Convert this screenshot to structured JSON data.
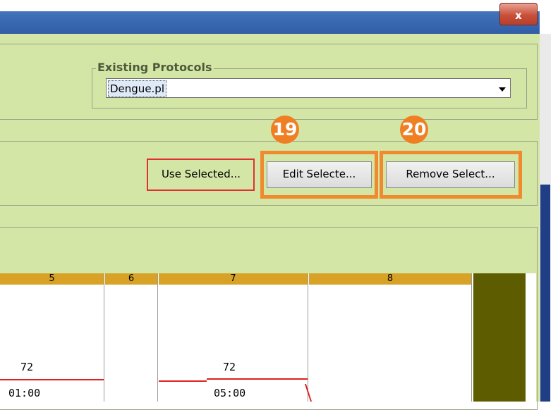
{
  "window": {
    "close_label": "x"
  },
  "protocols": {
    "legend": "Existing Protocols",
    "selected_value": "Dengue.pl"
  },
  "actions": {
    "use_selected": "Use Selected...",
    "edit_selected": "Edit Selecte...",
    "remove_selected": "Remove Select..."
  },
  "callouts": {
    "badge_edit": "19",
    "badge_remove": "20"
  },
  "grid": {
    "columns": [
      "5",
      "6",
      "7",
      "8"
    ],
    "values": {
      "col5_value": "72",
      "col5_time": "01:00",
      "col7_value": "72",
      "col7_time": "05:00"
    }
  },
  "colors": {
    "panel_bg": "#d4e6a6",
    "header_gold": "#d8a227",
    "callout_orange": "#f08a2e",
    "highlight_red": "#e03030",
    "olive_column": "#5e5c00",
    "title_blue": "#3e6fb8"
  }
}
